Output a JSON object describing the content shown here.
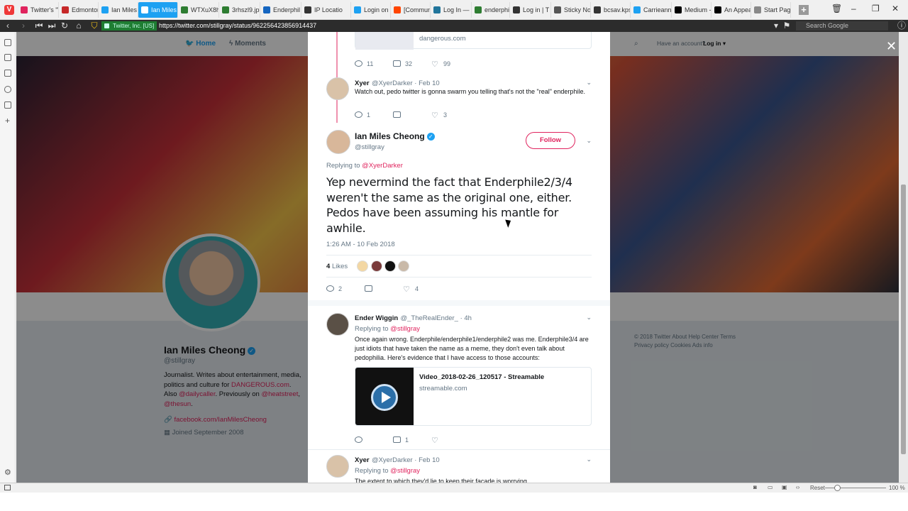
{
  "browser": {
    "tabs": [
      {
        "label": "Twitter's \"\\",
        "color": "#e0245e"
      },
      {
        "label": "Edmonton",
        "color": "#c62828"
      },
      {
        "label": "Ian Miles",
        "color": "#1da1f2"
      },
      {
        "label": "Ian Miles",
        "color": "#1da1f2",
        "active": true
      },
      {
        "label": "WTXuX8h",
        "color": "#2e7d32"
      },
      {
        "label": "3rhszl9.jp",
        "color": "#2e7d32"
      },
      {
        "label": "Enderphil",
        "color": "#1565c0"
      },
      {
        "label": "IP Locatio",
        "color": "#333333"
      },
      {
        "label": "Login on",
        "color": "#1da1f2"
      },
      {
        "label": "[Commun",
        "color": "#ff4500"
      },
      {
        "label": "Log In —",
        "color": "#21759b"
      },
      {
        "label": "enderphil",
        "color": "#2e7d32"
      },
      {
        "label": "Log in | T",
        "color": "#333333"
      },
      {
        "label": "Sticky No",
        "color": "#555555"
      },
      {
        "label": "bcsav.kps",
        "color": "#333333"
      },
      {
        "label": "Carrieann",
        "color": "#1da1f2"
      },
      {
        "label": "Medium -",
        "color": "#000000"
      },
      {
        "label": "An Appea",
        "color": "#000000"
      },
      {
        "label": "Start Page",
        "color": "#888888"
      }
    ],
    "site_badge": "Twitter, Inc. [US]",
    "url": "https://twitter.com/stillgray/status/962256423856914437",
    "search_placeholder": "Search Google",
    "status_reset": "Reset",
    "status_zoom": "100 %"
  },
  "twitter_nav": {
    "home": "Home",
    "moments": "Moments",
    "have_account": "Have an account?",
    "login": "Log in ▾"
  },
  "profile": {
    "name": "Ian Miles Cheong",
    "handle": "@stillgray",
    "bio_1": "Journalist. Writes about entertainment, media, politics and culture for ",
    "bio_link_1": "DANGEROUS.com",
    "bio_2": ". Also ",
    "bio_link_2": "@dailycaller",
    "bio_3": ". Previously on ",
    "bio_link_3": "@heatstreet",
    "bio_4": ", ",
    "bio_link_4": "@thesun",
    "bio_5": ".",
    "link": "facebook.com/IanMilesCheong",
    "joined": "Joined September 2008"
  },
  "footer": {
    "line1": "© 2018 Twitter   About   Help Center   Terms",
    "line2": "Privacy policy   Cookies   Ads info"
  },
  "modal": {
    "top_card_domain": "dangerous.com",
    "top_actions": {
      "replies": "11",
      "retweets": "32",
      "likes": "99"
    },
    "reply1": {
      "name": "Xyer",
      "meta": "@XyerDarker · Feb 10",
      "text": "Watch out, pedo twitter is gonna swarm you telling that's not the \"real\" enderphile.",
      "replies": "1",
      "retweets": "",
      "likes": "3"
    },
    "main": {
      "name": "Ian Miles Cheong",
      "handle": "@stillgray",
      "follow": "Follow",
      "replying_label": "Replying to ",
      "replying_to": "@XyerDarker",
      "text": "Yep nevermind the fact that Enderphile2/3/4 weren't the same as the original one, either. Pedos have been assuming his mantle for awhile.",
      "time": "1:26 AM - 10 Feb 2018",
      "likes_count": "4",
      "likes_label": "Likes",
      "replies": "2",
      "retweets": "",
      "likes": "4"
    },
    "reply2": {
      "name": "Ender Wiggin",
      "meta": "@_TheRealEnder_ · 4h",
      "replying_label": "Replying to ",
      "replying_to": "@stillgray",
      "text": "Once again wrong. Enderphile/enderphile1/enderphile2 was me. Enderphile3/4 are just idiots that have taken the name as a meme, they don't even talk about pedophilia. Here's evidence that I have access to those accounts:",
      "card_title": "Video_2018-02-26_120517 - Streamable",
      "card_domain": "streamable.com",
      "replies": "",
      "retweets": "1",
      "likes": ""
    },
    "reply3": {
      "name": "Xyer",
      "meta": "@XyerDarker · Feb 10",
      "replying_label": "Replying to ",
      "replying_to": "@stillgray",
      "text": "The extent to which they'd lie to keep their facade is worrying."
    }
  },
  "colors": {
    "twitter_blue": "#1da1f2",
    "link_red": "#e0245e",
    "muted": "#657786"
  }
}
